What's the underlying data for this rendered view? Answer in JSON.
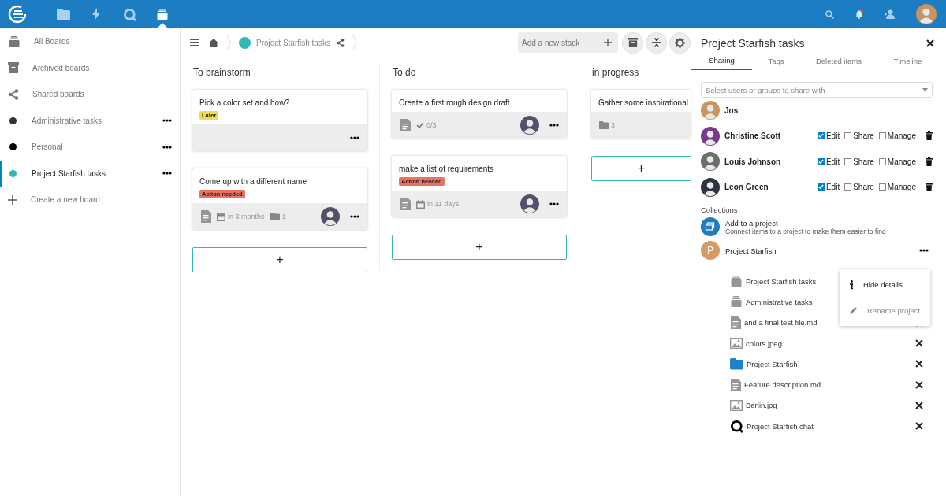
{
  "topbar": {
    "apps": [
      {
        "kind": "files",
        "selected": false
      },
      {
        "kind": "activity",
        "selected": false
      },
      {
        "kind": "talk",
        "selected": false
      },
      {
        "kind": "deck",
        "selected": true
      }
    ],
    "notifications": {
      "unread": true
    }
  },
  "sidebar": {
    "items": [
      {
        "label": "All Boards",
        "kind": "all",
        "selected": false
      },
      {
        "label": "Archived boards",
        "kind": "archive",
        "selected": false
      },
      {
        "label": "Shared boards",
        "kind": "shared",
        "selected": false
      },
      {
        "label": "Administrative tasks",
        "kind": "board",
        "color": "#333333",
        "selected": false
      },
      {
        "label": "Personal",
        "kind": "board",
        "color": "#000000",
        "selected": false
      },
      {
        "label": "Project Starfish tasks",
        "kind": "board",
        "color": "#31b8b4",
        "selected": true
      },
      {
        "label": "Create a new board",
        "kind": "create",
        "selected": false
      }
    ]
  },
  "breadcrumb": {
    "board": "Project Starfish tasks",
    "color": "#31b8b4"
  },
  "toolbar": {
    "placeholder": "Add a new stack"
  },
  "stacks": [
    {
      "title": "To brainstorm",
      "add": "+",
      "cards": [
        {
          "title": "Pick a color set and how?",
          "labels": [
            {
              "text": "Later",
              "color": "#f1db50"
            }
          ],
          "description": false,
          "assigned": false
        },
        {
          "title": "Come up with a different name",
          "labels": [
            {
              "text": "Action needed",
              "color": "#ec7162"
            }
          ],
          "description": true,
          "due": "in 3 months",
          "attachments": "1",
          "assigned": true
        }
      ]
    },
    {
      "title": "To do",
      "add": "+",
      "cards": [
        {
          "title": "Create a first rough design draft",
          "description": true,
          "checklist": "0/3",
          "assigned": true
        },
        {
          "title": "make a list of requirements",
          "labels": [
            {
              "text": "Action needed",
              "color": "#ec7162"
            }
          ],
          "description": true,
          "due": "in 11 days",
          "assigned": true
        }
      ]
    },
    {
      "title": "in progress",
      "add": "+",
      "cards": [
        {
          "title": "Gather some inspirational",
          "description": false,
          "attachments": "3",
          "assigned": false
        }
      ]
    }
  ],
  "panel": {
    "title": "Project Starfish tasks",
    "tabs": [
      {
        "label": "Sharing",
        "selected": true
      },
      {
        "label": "Tags",
        "selected": false
      },
      {
        "label": "Deleted items",
        "selected": false
      },
      {
        "label": "Timeline",
        "selected": false
      }
    ],
    "share_field": {
      "placeholder": "Select users or groups to share with"
    },
    "shares": [
      {
        "name": "Jos",
        "kind": "owner"
      },
      {
        "name": "Christine Scott",
        "kind": "user",
        "permissions": [
          {
            "label": "Edit",
            "checked": true
          },
          {
            "label": "Share",
            "checked": false
          },
          {
            "label": "Manage",
            "checked": false
          }
        ]
      },
      {
        "name": "Louis Johnson",
        "kind": "user",
        "permissions": [
          {
            "label": "Edit",
            "checked": true
          },
          {
            "label": "Share",
            "checked": false
          },
          {
            "label": "Manage",
            "checked": false
          }
        ]
      },
      {
        "name": "Leon Green",
        "kind": "user",
        "permissions": [
          {
            "label": "Edit",
            "checked": true
          },
          {
            "label": "Share",
            "checked": false
          },
          {
            "label": "Manage",
            "checked": false
          }
        ]
      }
    ],
    "collections": {
      "heading": "Collections",
      "add": {
        "title": "Add to a project",
        "subtitle": "Connect items to a project to make them easier to find"
      },
      "project": {
        "initial": "P",
        "name": "Project Starfish"
      },
      "items": [
        {
          "name": "Project Starfish tasks",
          "kind": "deck",
          "removable": false
        },
        {
          "name": "Administrative tasks",
          "kind": "deck",
          "removable": false
        },
        {
          "name": "and a final test file.md",
          "kind": "file",
          "removable": true
        },
        {
          "name": "colors.jpeg",
          "kind": "image",
          "removable": true
        },
        {
          "name": "Project Starfish",
          "kind": "folder",
          "removable": true
        },
        {
          "name": "Feature description.md",
          "kind": "file",
          "removable": true
        },
        {
          "name": "Berlin.jpg",
          "kind": "image",
          "removable": true
        },
        {
          "name": "Project Starfish chat",
          "kind": "talk",
          "removable": true
        }
      ],
      "menu": [
        {
          "label": "Hide details",
          "kind": "info",
          "disabled": false
        },
        {
          "label": "Rename project",
          "kind": "rename",
          "disabled": true
        }
      ]
    }
  }
}
